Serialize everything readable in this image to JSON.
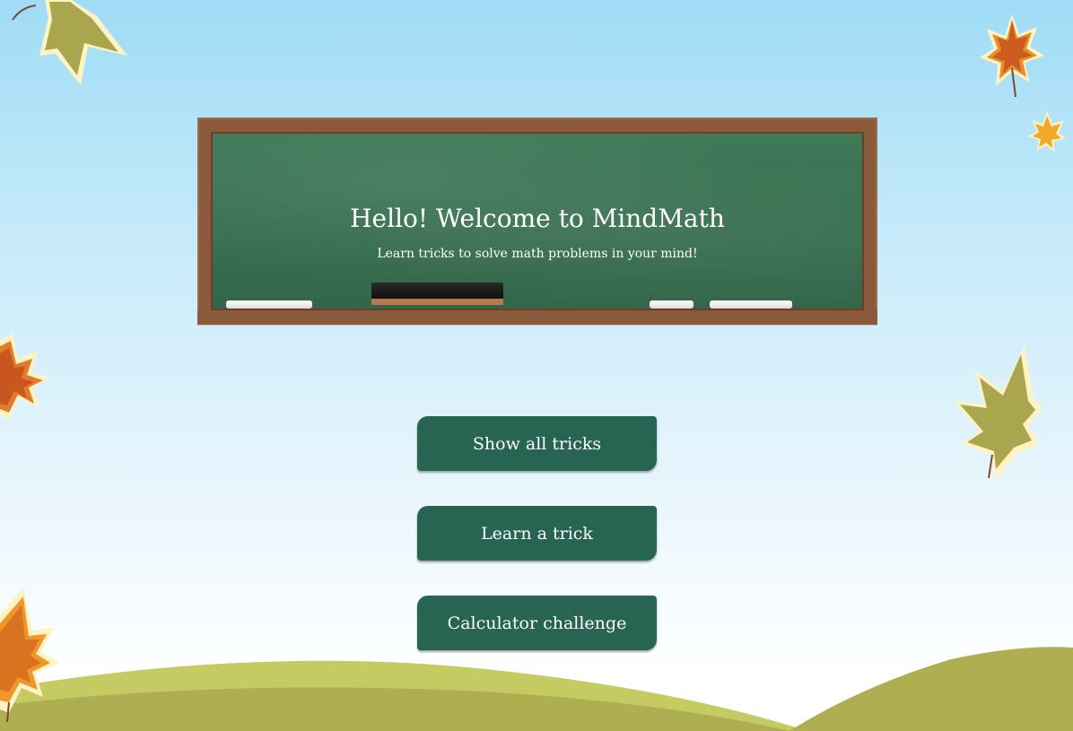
{
  "header": {
    "title": "Hello! Welcome to MindMath",
    "subtitle": "Learn tricks to solve math problems in your mind!"
  },
  "menu": {
    "buttons": [
      {
        "label": "Show all tricks"
      },
      {
        "label": "Learn a trick"
      },
      {
        "label": "Calculator challenge"
      }
    ]
  },
  "colors": {
    "button_bg": "#286452",
    "chalkboard": "#3a7152",
    "frame": "#8a5a3a",
    "hill_light": "#c5cb63",
    "hill_dark": "#afae50"
  },
  "icons": [
    "maple-leaf-icon",
    "chalk-icon",
    "eraser-icon"
  ]
}
